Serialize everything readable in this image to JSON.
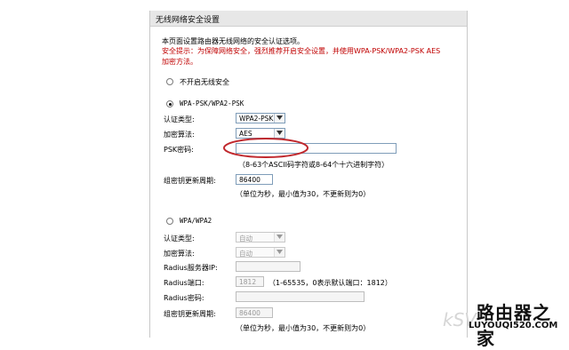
{
  "panel": {
    "title": "无线网络安全设置"
  },
  "intro": "本页面设置路由器无线网络的安全认证选项。",
  "warning": {
    "line1": "安全提示：为保障网络安全，强烈推荐开启安全设置，并使用WPA-PSK/WPA2-PSK AES",
    "line2": "加密方法。"
  },
  "no_security": {
    "label": "不开启无线安全",
    "checked": false
  },
  "psk_section": {
    "label": "WPA-PSK/WPA2-PSK",
    "checked": true,
    "auth_label": "认证类型:",
    "auth_value": "WPA2-PSK",
    "cipher_label": "加密算法:",
    "cipher_value": "AES",
    "psk_label": "PSK密码:",
    "psk_value": "",
    "psk_hint": "（8-63个ASCII码字符或8-64个十六进制字符）",
    "renew_label": "组密钥更新周期:",
    "renew_value": "86400",
    "renew_hint": "（单位为秒，最小值为30，不更新则为0）"
  },
  "wpa_section": {
    "label": "WPA/WPA2",
    "checked": false,
    "auth_label": "认证类型:",
    "auth_value": "自动",
    "cipher_label": "加密算法:",
    "cipher_value": "自动",
    "radius_ip_label": "Radius服务器IP:",
    "radius_ip_value": "",
    "radius_port_label": "Radius端口:",
    "radius_port_value": "1812",
    "radius_port_hint": "（1-65535，0表示默认端口：1812）",
    "radius_pwd_label": "Radius密码:",
    "radius_pwd_value": "",
    "renew_label": "组密钥更新周期:",
    "renew_value": "86400",
    "renew_hint": "（单位为秒，最小值为30，不更新则为0）"
  },
  "branding": {
    "watermark": "kSV",
    "logo_text": "路由器之家",
    "logo_url": "LUYOUQI520.COM"
  },
  "colors": {
    "warning": "#c00000",
    "highlight_ellipse": "#c0282d",
    "header_bg": "#e7e7e7"
  }
}
